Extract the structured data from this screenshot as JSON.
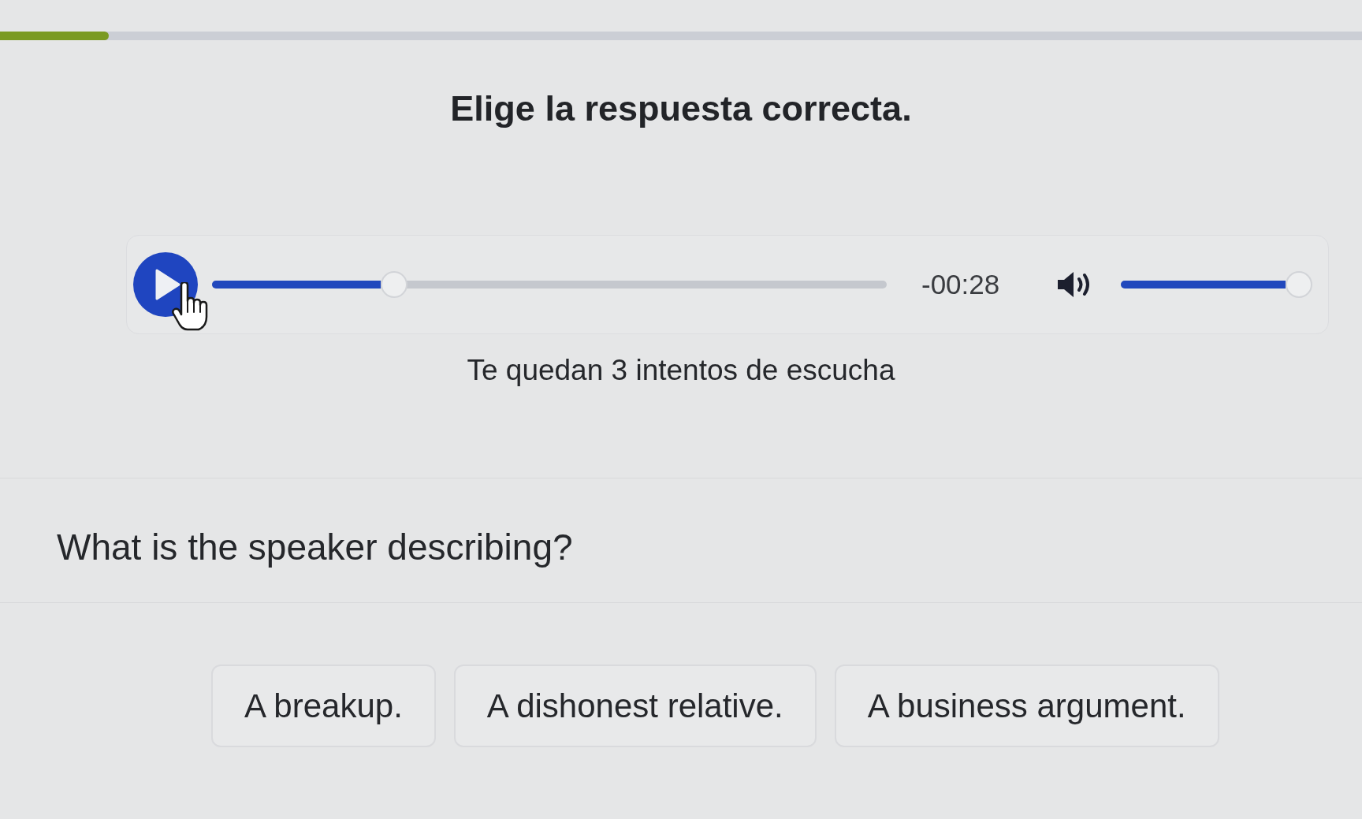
{
  "lesson_progress": {
    "level": 0.08
  },
  "title": "Elige la respuesta correcta.",
  "player": {
    "seek": {
      "level": 0.25
    },
    "time": "-00:28",
    "volume": {
      "level": 1
    }
  },
  "attempts_text": "Te quedan 3 intentos de escucha",
  "question": "What is the speaker describing?",
  "options": [
    {
      "label": "A breakup.",
      "selected": false
    },
    {
      "label": "A dishonest relative.",
      "selected": false
    },
    {
      "label": "A business argument.",
      "selected": false
    }
  ]
}
